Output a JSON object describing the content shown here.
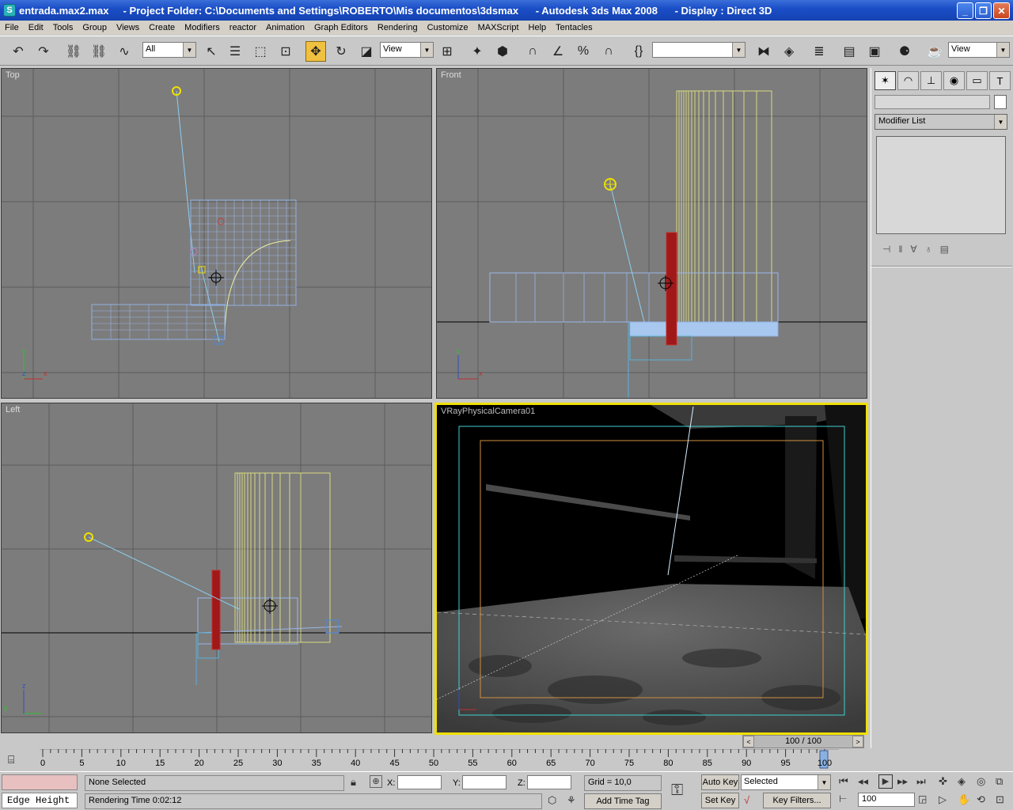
{
  "window": {
    "title": "entrada.max2.max     - Project Folder: C:\\Documents and Settings\\ROBERTO\\Mis documentos\\3dsmax      - Autodesk 3ds Max 2008      - Display : Direct 3D",
    "app_icon": "3ds-max-icon"
  },
  "menu": [
    "File",
    "Edit",
    "Tools",
    "Group",
    "Views",
    "Create",
    "Modifiers",
    "reactor",
    "Animation",
    "Graph Editors",
    "Rendering",
    "Customize",
    "MAXScript",
    "Help",
    "Tentacles"
  ],
  "toolbar": {
    "selection_filter": "All",
    "reference_coord": "View",
    "named_selection": "",
    "render_dropdown": "View"
  },
  "viewports": {
    "top_label": "Top",
    "front_label": "Front",
    "left_label": "Left",
    "camera_label": "VRayPhysicalCamera01"
  },
  "command_panel": {
    "modifier_list": "Modifier List",
    "tabs": [
      "create-icon",
      "modify-icon",
      "hierarchy-icon",
      "motion-icon",
      "display-icon",
      "utilities-icon"
    ]
  },
  "time": {
    "slider_label": "100 / 100",
    "ticks": [
      "0",
      "5",
      "10",
      "15",
      "20",
      "25",
      "30",
      "35",
      "40",
      "45",
      "50",
      "55",
      "60",
      "65",
      "70",
      "75",
      "80",
      "85",
      "90",
      "95",
      "100"
    ]
  },
  "status": {
    "selection": "None Selected",
    "render_time": "Rendering Time  0:02:12",
    "x_label": "X:",
    "y_label": "Y:",
    "z_label": "Z:",
    "grid": "Grid = 10,0",
    "add_time_tag": "Add Time Tag",
    "auto_key": "Auto Key",
    "set_key": "Set Key",
    "key_mode": "Selected",
    "key_filters": "Key Filters...",
    "current_frame": "100",
    "maxscript": "Edge Height"
  }
}
